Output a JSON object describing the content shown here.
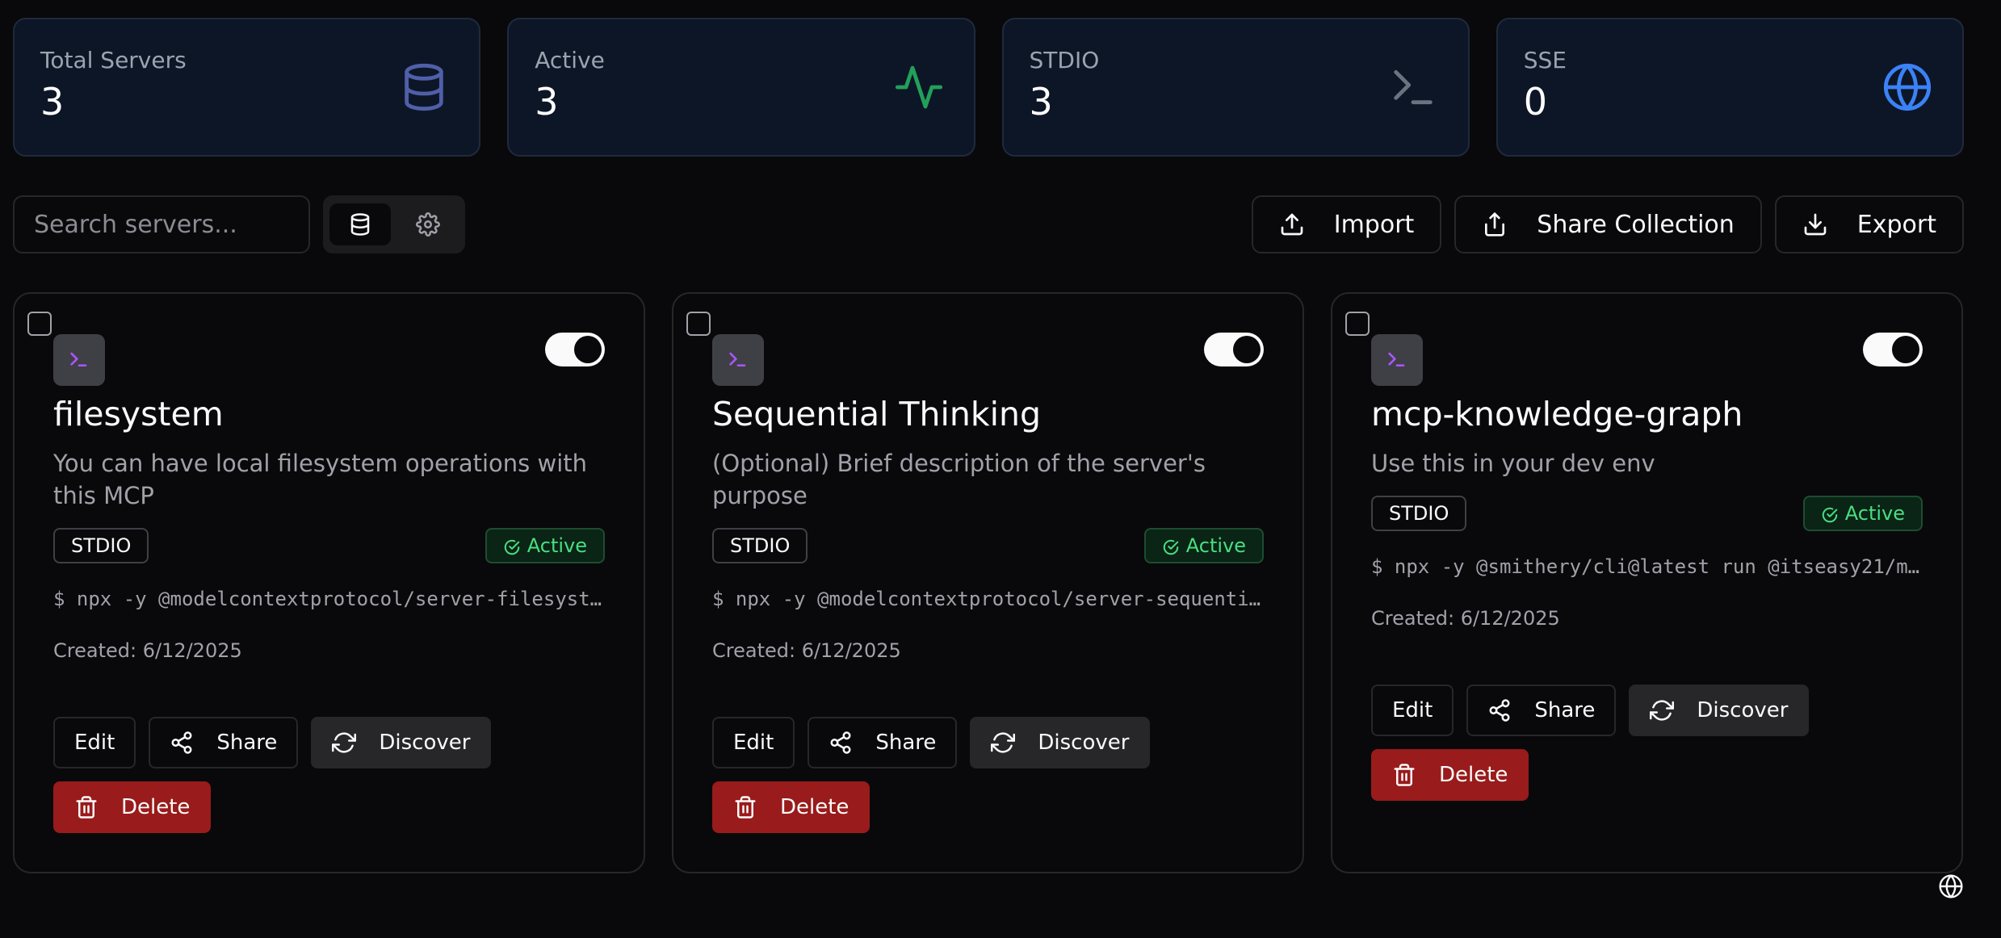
{
  "stats": [
    {
      "label": "Total Servers",
      "value": "3",
      "icon": "database-icon",
      "color": "#4f5fa8"
    },
    {
      "label": "Active",
      "value": "3",
      "icon": "activity-icon",
      "color": "#22a05a"
    },
    {
      "label": "STDIO",
      "value": "3",
      "icon": "terminal-icon",
      "color": "#6b7280"
    },
    {
      "label": "SSE",
      "value": "0",
      "icon": "globe-icon",
      "color": "#3b82f6"
    }
  ],
  "toolbar": {
    "search_placeholder": "Search servers...",
    "import_label": "Import",
    "share_collection_label": "Share Collection",
    "export_label": "Export"
  },
  "servers": [
    {
      "name": "filesystem",
      "description": "You can have local filesystem operations with this MCP",
      "type": "STDIO",
      "status": "Active",
      "command": "$ npx -y @modelcontextprotocol/server-filesyst…",
      "created": "Created: 6/12/2025",
      "enabled": true
    },
    {
      "name": "Sequential Thinking",
      "description": "(Optional) Brief description of the server's purpose",
      "type": "STDIO",
      "status": "Active",
      "command": "$ npx -y @modelcontextprotocol/server-sequenti…",
      "created": "Created: 6/12/2025",
      "enabled": true
    },
    {
      "name": "mcp-knowledge-graph",
      "description": "Use this in your dev env",
      "type": "STDIO",
      "status": "Active",
      "command": "$ npx -y @smithery/cli@latest run @itseasy21/m…",
      "created": "Created: 6/12/2025",
      "enabled": true
    }
  ],
  "card_actions": {
    "edit": "Edit",
    "share": "Share",
    "discover": "Discover",
    "delete": "Delete"
  },
  "colors": {
    "accent_purple": "#a855f7",
    "active_green": "#4ade80",
    "delete_red": "#991b1b"
  }
}
